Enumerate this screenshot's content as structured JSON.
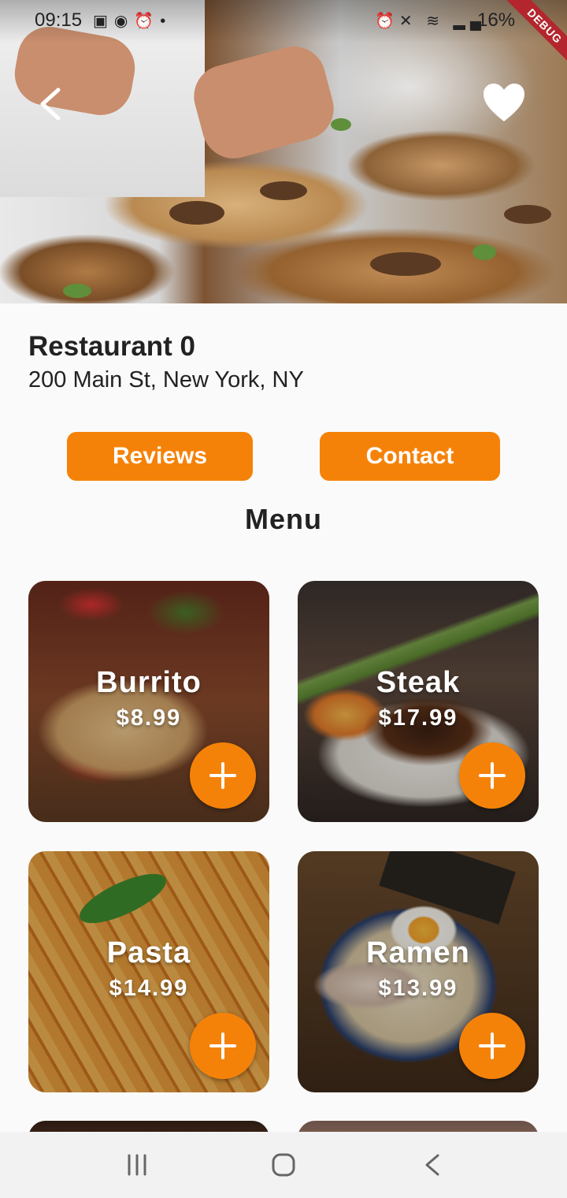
{
  "status_bar": {
    "time": "09:15",
    "left_icons": [
      "image-icon",
      "messenger-icon",
      "alarm-icon",
      "dot-icon"
    ],
    "right_icons": [
      "alarm-icon",
      "mute-icon",
      "wifi-icon",
      "signal-icon"
    ],
    "battery": "16%",
    "debug_banner": "DEBUG"
  },
  "header": {
    "back_icon": "chevron-left-icon",
    "favorite_icon": "heart-icon"
  },
  "restaurant": {
    "name": "Restaurant 0",
    "address": "200 Main St, New York, NY"
  },
  "actions": {
    "reviews_label": "Reviews",
    "contact_label": "Contact"
  },
  "menu": {
    "title": "Menu",
    "items": [
      {
        "name": "Burrito",
        "price": "$8.99",
        "add_icon": "plus-icon"
      },
      {
        "name": "Steak",
        "price": "$17.99",
        "add_icon": "plus-icon"
      },
      {
        "name": "Pasta",
        "price": "$14.99",
        "add_icon": "plus-icon"
      },
      {
        "name": "Ramen",
        "price": "$13.99",
        "add_icon": "plus-icon"
      }
    ]
  },
  "colors": {
    "accent": "#f58208",
    "background": "#fafafa",
    "navbar": "#f2f2f2",
    "debug": "#b3262d"
  },
  "navbar": {
    "icons": [
      "recent-apps-icon",
      "home-icon",
      "back-icon"
    ]
  }
}
